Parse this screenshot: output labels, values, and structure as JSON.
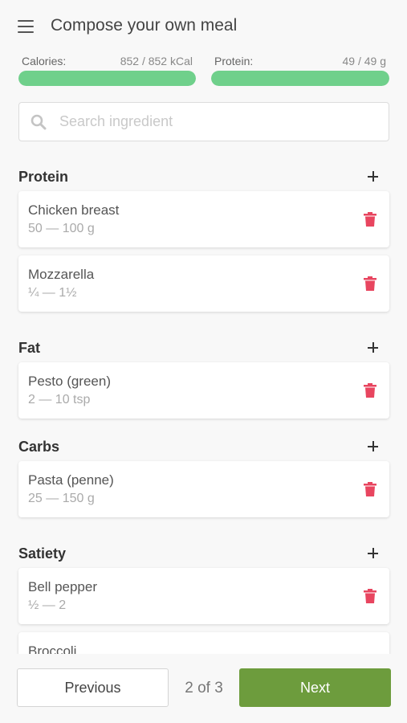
{
  "header": {
    "title": "Compose your own meal",
    "menu_icon": "hamburger-menu-icon"
  },
  "meters": {
    "calories": {
      "label": "Calories:",
      "value": "852 / 852 kCal",
      "fill_fraction": 1.0
    },
    "protein": {
      "label": "Protein:",
      "value": "49 / 49 g",
      "fill_fraction": 1.0
    }
  },
  "search": {
    "placeholder": "Search ingredient",
    "value": "",
    "icon": "search-icon"
  },
  "sections": [
    {
      "title": "Protein",
      "items": [
        {
          "name": "Chicken breast",
          "range": "50 — 100 g"
        },
        {
          "name": "Mozzarella",
          "range": "¼ — 1½"
        }
      ]
    },
    {
      "title": "Fat",
      "items": [
        {
          "name": "Pesto (green)",
          "range": "2 — 10 tsp"
        }
      ]
    },
    {
      "title": "Carbs",
      "items": [
        {
          "name": "Pasta (penne)",
          "range": "25 — 150 g"
        }
      ]
    },
    {
      "title": "Satiety",
      "items": [
        {
          "name": "Bell pepper",
          "range": "½ — 2"
        },
        {
          "name": "Broccoli",
          "range": ""
        }
      ]
    }
  ],
  "footer": {
    "previous_label": "Previous",
    "page_indicator": "2 of 3",
    "next_label": "Next"
  },
  "colors": {
    "meter_fill": "#6fd08b",
    "accent_green": "#6d9c3d",
    "trash_red": "#e8455f"
  }
}
